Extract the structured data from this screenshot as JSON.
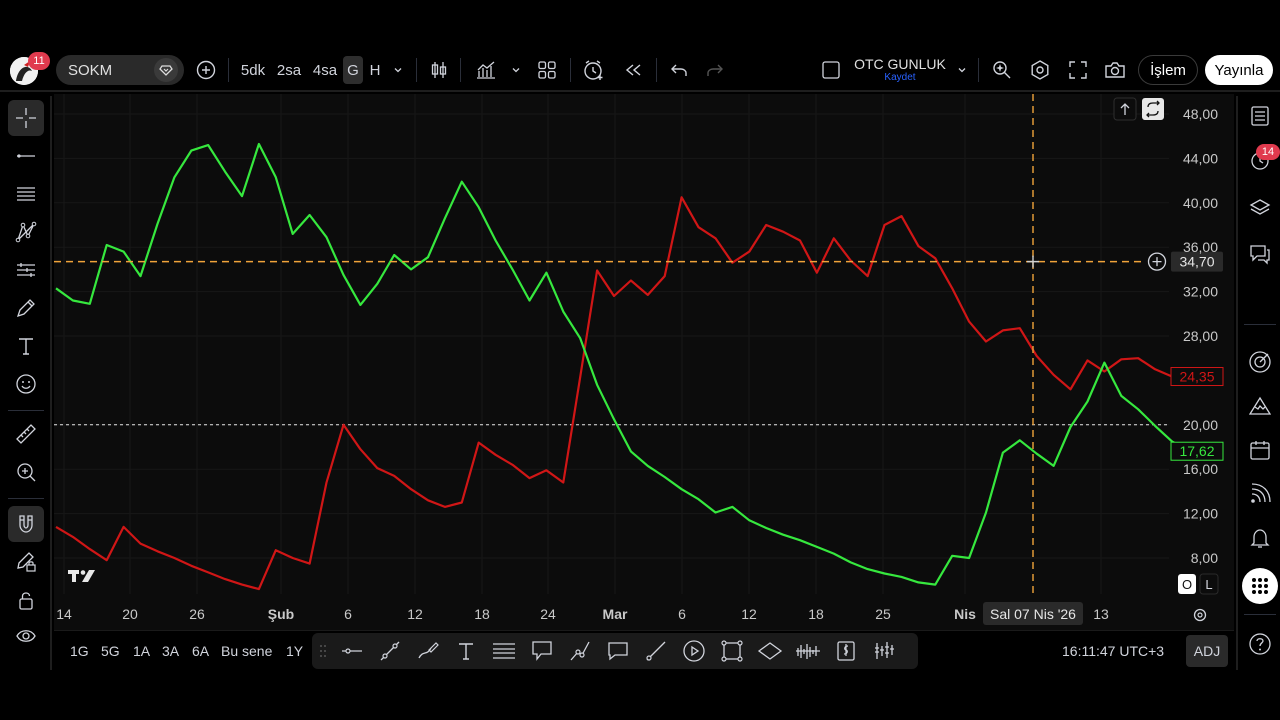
{
  "topbar": {
    "avatar_badge": "11",
    "symbol": "SOKM",
    "timeframes": [
      "5dk",
      "2sa",
      "4sa",
      "G",
      "H"
    ],
    "active_timeframe": "G",
    "layout_name": "OTC GUNLUK",
    "layout_sub": "Kaydet",
    "islem_label": "İşlem",
    "yayinla_label": "Yayınla"
  },
  "right_tools": {
    "alerts_badge": "14"
  },
  "bottombar": {
    "ranges": [
      "1G",
      "5G",
      "1A",
      "3A",
      "6A",
      "Bu sene",
      "1Y"
    ],
    "clock": "16:11:47 UTC+3",
    "adj_label": "ADJ"
  },
  "colors": {
    "background": "#0c0c0c",
    "red_series": "#d01616",
    "green_series": "#36e83e",
    "crosshair": "#f0a33a",
    "grid": "#171717"
  },
  "chart_data": {
    "type": "line",
    "y_ticks": [
      "48,00",
      "44,00",
      "40,00",
      "36,00",
      "32,00",
      "28,00",
      "20,00",
      "16,00",
      "12,00",
      "8,00"
    ],
    "ylim": [
      5.0,
      49.0
    ],
    "x_labels": [
      "14",
      "20",
      "26",
      "Şub",
      "6",
      "12",
      "18",
      "24",
      "Mar",
      "6",
      "12",
      "18",
      "25",
      "Nis",
      "13"
    ],
    "grid": true,
    "crosshair": {
      "price_label": "34,70",
      "date_label": "Sal 07 Nis '26"
    },
    "reference_line": 20.0,
    "series": [
      {
        "color": "red",
        "last_value_label": "24,35",
        "values": [
          10.8,
          9.9,
          8.8,
          7.8,
          10.8,
          9.3,
          8.6,
          8.0,
          7.3,
          6.7,
          6.1,
          5.6,
          5.2,
          8.7,
          8.0,
          7.5,
          14.8,
          20.0,
          17.8,
          16.1,
          15.4,
          14.2,
          13.2,
          12.6,
          13.0,
          18.4,
          17.3,
          16.4,
          15.2,
          15.9,
          14.8,
          24.3,
          33.9,
          31.6,
          33.0,
          31.7,
          33.4,
          40.5,
          37.8,
          36.8,
          34.6,
          35.6,
          38.0,
          37.4,
          36.6,
          33.7,
          36.8,
          34.8,
          33.4,
          38.0,
          38.8,
          36.1,
          35.0,
          32.3,
          29.3,
          27.5,
          28.5,
          28.7,
          26.2,
          24.5,
          23.2,
          25.8,
          24.8,
          25.9,
          26.0,
          25.0,
          24.35
        ]
      },
      {
        "color": "green",
        "last_value_label": "17,62",
        "values": [
          32.3,
          31.2,
          30.9,
          36.2,
          35.6,
          33.4,
          38.1,
          42.3,
          44.7,
          45.2,
          42.8,
          40.6,
          45.3,
          42.3,
          37.2,
          38.9,
          36.9,
          33.5,
          30.8,
          32.7,
          35.3,
          34.0,
          35.1,
          38.6,
          41.9,
          39.6,
          36.6,
          34.0,
          31.2,
          33.7,
          30.2,
          27.8,
          23.6,
          20.5,
          17.6,
          16.3,
          15.3,
          14.2,
          13.3,
          12.1,
          12.6,
          11.4,
          10.7,
          10.1,
          9.6,
          9.0,
          8.4,
          7.6,
          7.0,
          6.6,
          6.3,
          5.8,
          5.6,
          8.2,
          8.0,
          12.1,
          17.5,
          18.6,
          17.4,
          16.3,
          19.8,
          22.1,
          25.6,
          22.6,
          21.4,
          19.9,
          18.5,
          17.62
        ]
      }
    ]
  }
}
